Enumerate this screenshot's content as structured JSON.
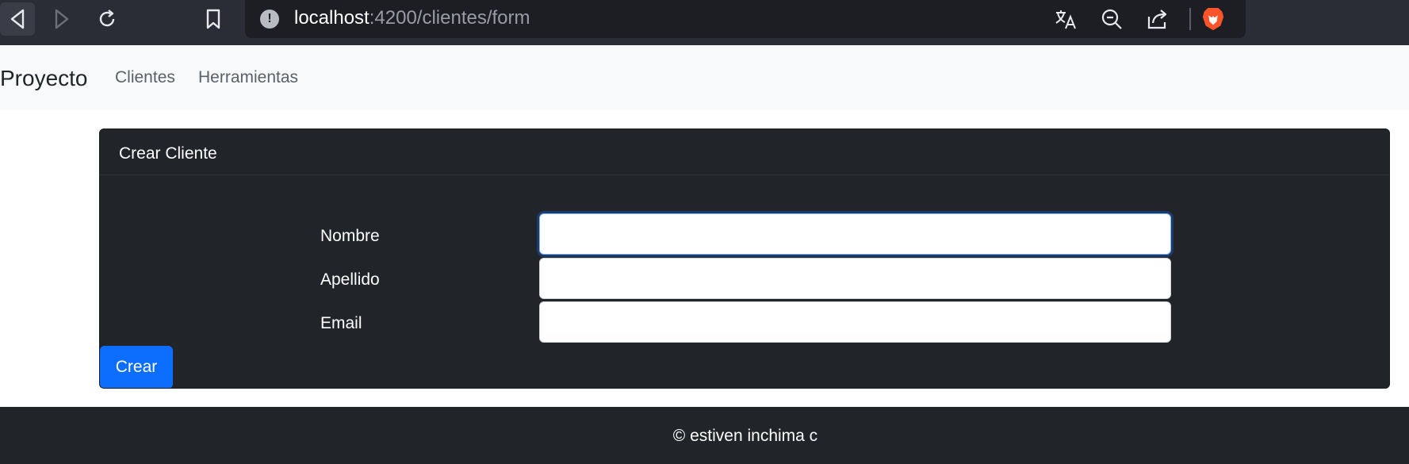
{
  "browser": {
    "url_host": "localhost",
    "url_path": ":4200/clientes/form",
    "icons": [
      "back-icon",
      "forward-icon",
      "reload-icon",
      "bookmark-icon",
      "site-info-icon",
      "translate-icon",
      "zoom-out-icon",
      "share-icon",
      "brave-lion-icon"
    ]
  },
  "navbar": {
    "brand": "Proyecto",
    "links": [
      {
        "label": "Clientes"
      },
      {
        "label": "Herramientas"
      }
    ]
  },
  "form": {
    "title": "Crear Cliente",
    "fields": [
      {
        "label": "Nombre",
        "value": ""
      },
      {
        "label": "Apellido",
        "value": ""
      },
      {
        "label": "Email",
        "value": ""
      }
    ],
    "submit_label": "Crear"
  },
  "footer": {
    "text": "© estiven inchima c"
  },
  "colors": {
    "primary": "#0d6efd",
    "card_bg": "#212529",
    "navbar_bg": "#f8f9fa",
    "brave_orange": "#fb542b"
  }
}
